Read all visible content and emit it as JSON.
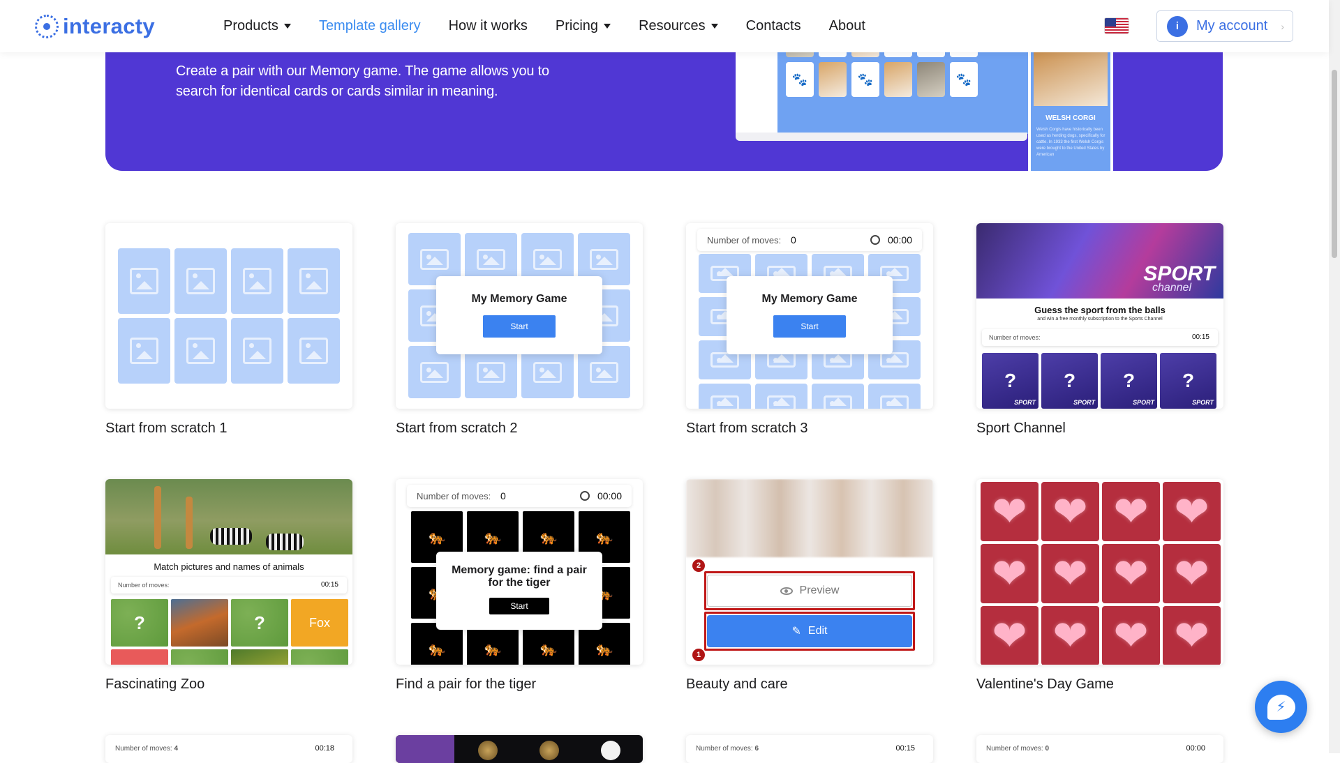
{
  "header": {
    "logo_text": "interacty",
    "nav": [
      {
        "label": "Products",
        "has_menu": true
      },
      {
        "label": "Template gallery",
        "active": true
      },
      {
        "label": "How it works"
      },
      {
        "label": "Pricing",
        "has_menu": true
      },
      {
        "label": "Resources",
        "has_menu": true
      },
      {
        "label": "Contacts"
      },
      {
        "label": "About"
      }
    ],
    "language_flag": "us-flag-icon",
    "account_label": "My account",
    "account_icon_letter": "i"
  },
  "banner": {
    "description": "Create a pair with our Memory game. The game allows you to search for identical cards or cards similar in meaning.",
    "phone_title": "WELSH CORGI",
    "phone_text": "Welsh Corgis have historically been used as herding dogs, specifically for cattle. In 1933 the first Welsh Corgis were brought to the United States by American"
  },
  "gallery": {
    "cards": [
      {
        "label": "Start from scratch 1"
      },
      {
        "label": "Start from scratch 2",
        "modal_title": "My Memory Game",
        "modal_button": "Start"
      },
      {
        "label": "Start from scratch 3",
        "moves_label": "Number of moves:",
        "moves_value": "0",
        "time": "00:00",
        "modal_title": "My Memory Game",
        "modal_button": "Start"
      },
      {
        "label": "Sport Channel",
        "brand": "SPORT",
        "brand_sub": "channel",
        "question": "Guess the sport from the balls",
        "subquestion": "and win a free monthly subscription to the Sports Channel",
        "moves_label": "Number of moves:",
        "time": "00:15",
        "card_mark": "?",
        "card_tag": "SPORT"
      },
      {
        "label": "Fascinating Zoo",
        "question": "Match pictures and names of animals",
        "moves_label": "Number of moves:",
        "time": "00:15",
        "card_mark": "?",
        "word_card": "Fox"
      },
      {
        "label": "Find a pair for the tiger",
        "moves_label": "Number of moves:",
        "moves_value": "0",
        "time": "00:00",
        "modal_title": "Memory game: find a pair for the tiger",
        "modal_button": "Start"
      },
      {
        "label": "Beauty and care",
        "preview_label": "Preview",
        "edit_label": "Edit",
        "badge_preview": "2",
        "badge_edit": "1"
      },
      {
        "label": "Valentine's Day Game"
      }
    ],
    "partial_row": [
      {
        "moves_label": "Number of moves:",
        "moves_value": "4",
        "time": "00:18"
      },
      {},
      {
        "moves_label": "Number of moves:",
        "moves_value": "6",
        "time": "00:15"
      },
      {
        "moves_label": "Number of moves:",
        "moves_value": "0",
        "time": "00:00"
      }
    ]
  },
  "icons": {
    "paw": "🐾",
    "tiger": "🐅",
    "heart": "❤",
    "dog": "🐕",
    "pencil": "✎",
    "messenger": "⚡"
  },
  "colors": {
    "brand_blue": "#3b6fe3",
    "banner_purple": "#5037d4",
    "tile_blue": "#b7d1fa",
    "button_blue": "#3b82f0",
    "highlight_red": "#c01818",
    "heart_red": "#b52e3e"
  }
}
